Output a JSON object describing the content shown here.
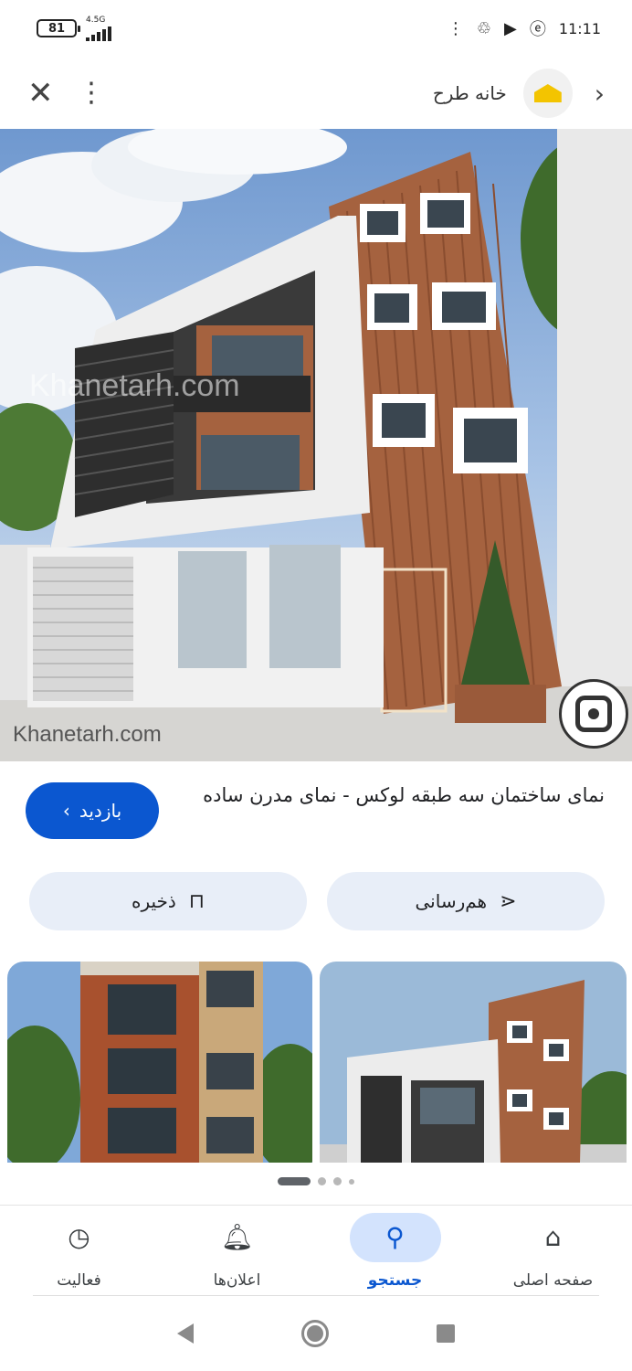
{
  "status_bar": {
    "battery": "81",
    "network": "4.5G",
    "time": "11:11"
  },
  "top_bar": {
    "site_name": "خانه طرح"
  },
  "image": {
    "watermark_top": "Khanetarh.com",
    "watermark_bottom": "Khanetarh.com"
  },
  "result": {
    "title": "نمای ساختمان سه طبقه لوکس - نمای مدرن ساده",
    "visit_label": "بازدید"
  },
  "actions": {
    "share_label": "هم‌رسانی",
    "save_label": "ذخیره"
  },
  "bottom_nav": {
    "items": [
      {
        "label": "صفحه اصلی",
        "icon": "home-icon"
      },
      {
        "label": "جستجو",
        "icon": "search-icon",
        "active": true
      },
      {
        "label": "اعلان‌ها",
        "icon": "bell-icon"
      },
      {
        "label": "فعالیت",
        "icon": "activity-icon"
      }
    ]
  },
  "colors": {
    "accent": "#0b57d0",
    "chip_bg": "#e8eef8",
    "nav_active_bg": "#d3e3fd"
  }
}
